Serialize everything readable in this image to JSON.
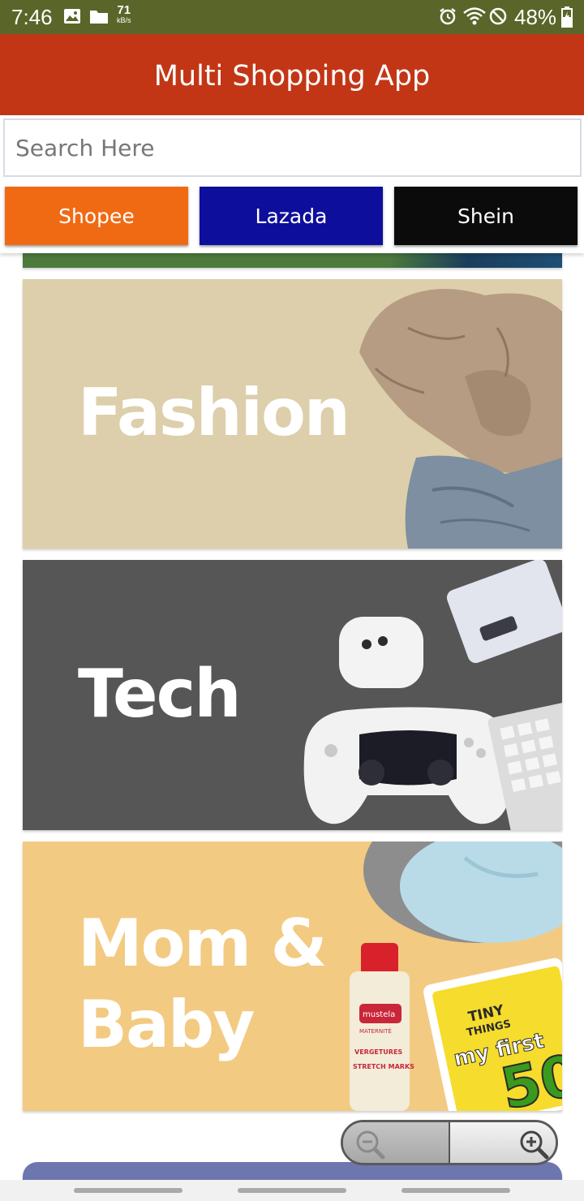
{
  "status_bar": {
    "time": "7:46",
    "net_speed": "71",
    "net_speed_unit": "kB/s",
    "battery": "48%",
    "icons": [
      "image-icon",
      "folder-icon",
      "alarm-icon",
      "wifi-icon",
      "do-not-disturb-icon",
      "battery-charging-icon"
    ]
  },
  "app_bar": {
    "title": "Multi Shopping App",
    "color": "#c23616"
  },
  "search": {
    "placeholder": "Search Here",
    "value": ""
  },
  "stores": [
    {
      "label": "Shopee",
      "color": "#f06a14"
    },
    {
      "label": "Lazada",
      "color": "#0e0e9c"
    },
    {
      "label": "Shein",
      "color": "#0b0b0b"
    }
  ],
  "banners": [
    {
      "label": "Fashion",
      "color": "#ddcfab"
    },
    {
      "label": "Tech",
      "color": "#565656"
    },
    {
      "label": "Mom & Baby",
      "color": "#f3ca82"
    }
  ],
  "product_text": {
    "bottle_brand": "mustela",
    "bottle_line1": "MATERNITÉ",
    "bottle_line2": "VERGETURES",
    "bottle_line3": "STRETCH MARKS",
    "book_brand1": "TINY",
    "book_brand2": "THINGS",
    "book_title": "my first",
    "book_number": "50"
  },
  "zoom": {
    "icons": [
      "zoom-out-icon",
      "zoom-in-icon"
    ]
  }
}
